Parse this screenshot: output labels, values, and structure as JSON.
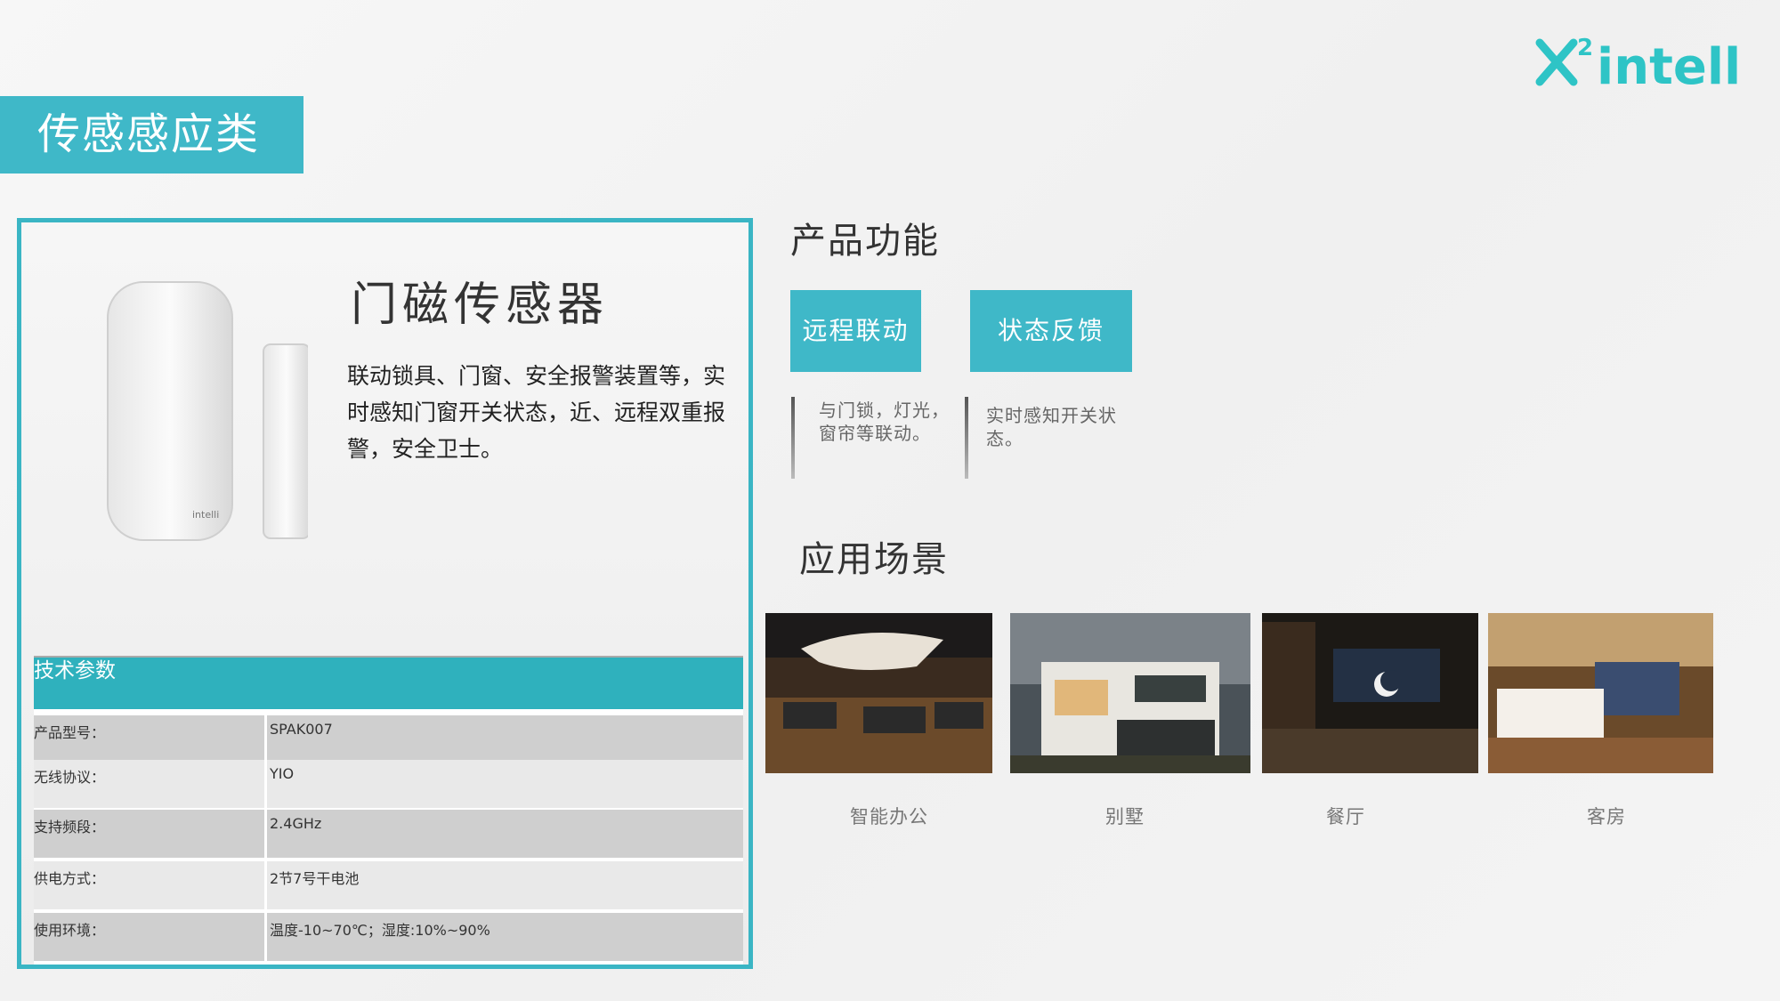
{
  "logo": {
    "text": "X²intelli",
    "icon": "x2intelli-logo"
  },
  "section_tag": "传感感应类",
  "product": {
    "name": "门磁传感器",
    "description": "联动锁具、门窗、安全报警装置等，实时感知门窗开关状态，近、远程双重报警，安全卫士。",
    "device_brand": "intelli",
    "specs_title": "技术参数",
    "specs": [
      {
        "label": "产品型号：",
        "value": "SPAK007"
      },
      {
        "label": "无线协议：",
        "value": "YIO"
      },
      {
        "label": "支持频段：",
        "value": "2.4GHz"
      },
      {
        "label": "供电方式：",
        "value": "2节7号干电池"
      },
      {
        "label": "使用环境：",
        "value": "温度-10~70℃；湿度:10%~90%"
      }
    ]
  },
  "features": {
    "heading": "产品功能",
    "items": [
      {
        "label": "远程联动",
        "desc_line1": "与门锁，灯光，",
        "desc_line2": "窗帘等联动。"
      },
      {
        "label": "状态反馈",
        "desc_line1": "实时感知开关状",
        "desc_line2": "态。"
      }
    ]
  },
  "scenes": {
    "heading": "应用场景",
    "items": [
      {
        "caption": "智能办公"
      },
      {
        "caption": "别墅"
      },
      {
        "caption": "餐厅"
      },
      {
        "caption": "客房"
      }
    ]
  },
  "colors": {
    "accent": "#3fb8c8",
    "table_header": "#2fb1bd"
  }
}
